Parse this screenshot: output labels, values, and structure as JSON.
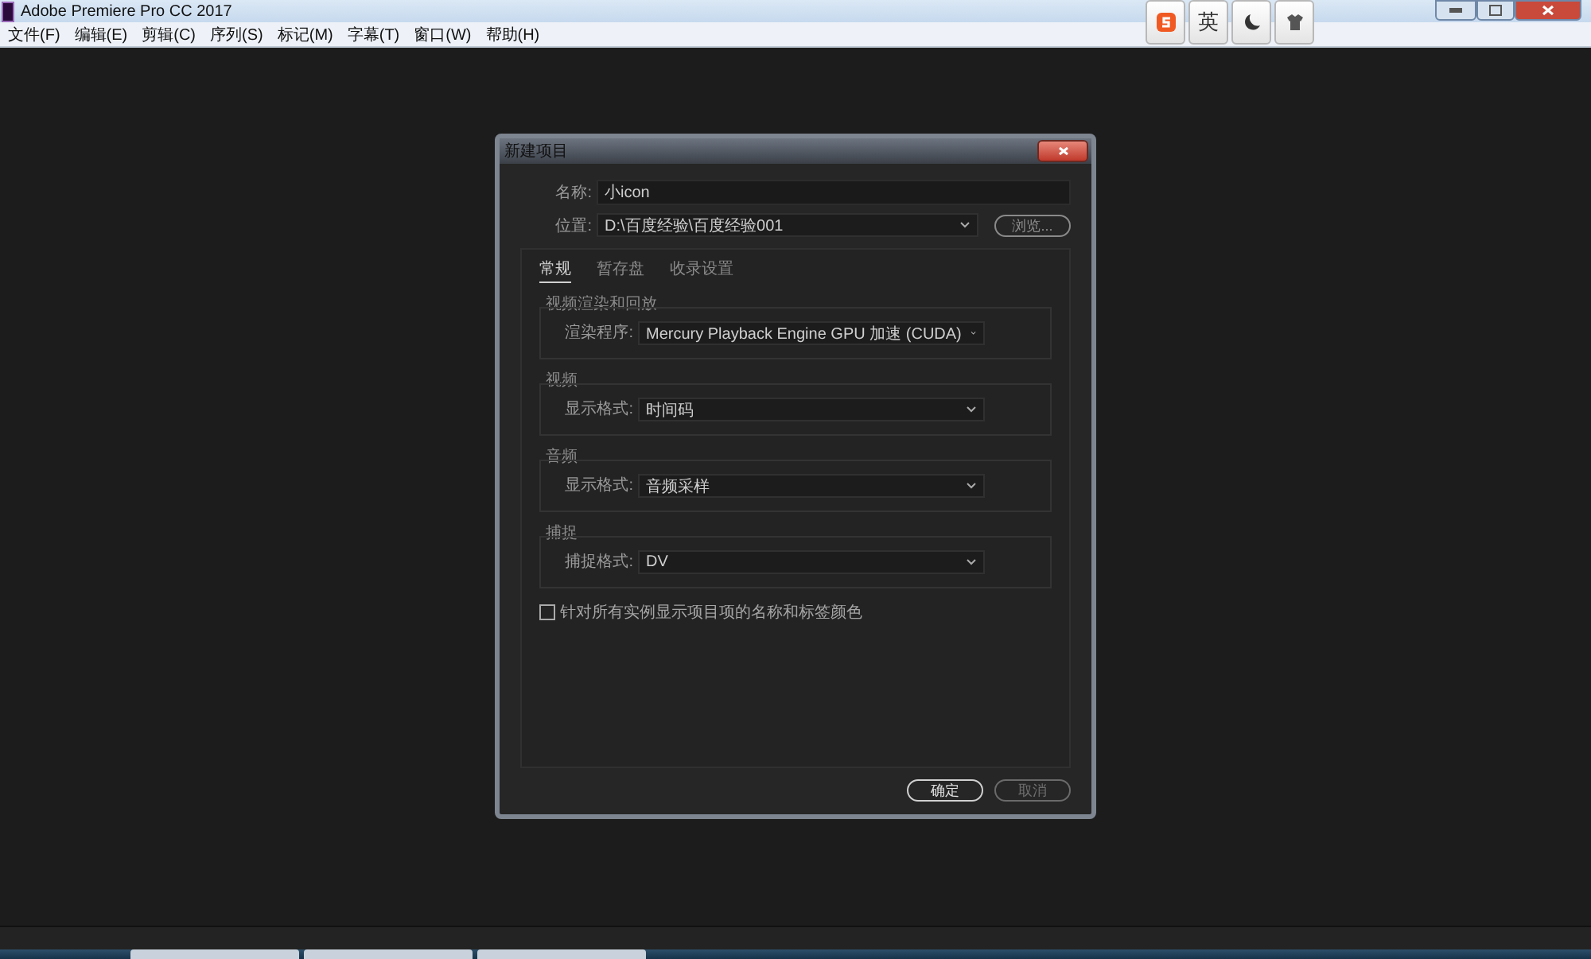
{
  "app_window": {
    "title": "Adobe Premiere Pro CC 2017"
  },
  "menu": [
    "文件(F)",
    "编辑(E)",
    "剪辑(C)",
    "序列(S)",
    "标记(M)",
    "字幕(T)",
    "窗口(W)",
    "帮助(H)"
  ],
  "ime_toolbar": {
    "language": "英"
  },
  "dialog": {
    "title": "新建项目",
    "name_field": {
      "label": "名称:",
      "value": "小icon"
    },
    "location_field": {
      "label": "位置:",
      "value": "D:\\百度经验\\百度经验001"
    },
    "browse_button": "浏览...",
    "tabs": [
      {
        "label": "常规",
        "selected": true
      },
      {
        "label": "暂存盘",
        "selected": false
      },
      {
        "label": "收录设置",
        "selected": false
      }
    ],
    "groups": [
      {
        "title": "视频渲染和回放",
        "label": "渲染程序:",
        "value": "Mercury Playback Engine GPU 加速 (CUDA)"
      },
      {
        "title": "视频",
        "label": "显示格式:",
        "value": "时间码"
      },
      {
        "title": "音频",
        "label": "显示格式:",
        "value": "音频采样"
      },
      {
        "title": "捕捉",
        "label": "捕捉格式:",
        "value": "DV"
      }
    ],
    "checkbox": {
      "label": "针对所有实例显示项目项的名称和标签颜色",
      "checked": false
    },
    "buttons": [
      {
        "label": "确定",
        "disabled": false
      },
      {
        "label": "取消",
        "disabled": true
      }
    ]
  }
}
